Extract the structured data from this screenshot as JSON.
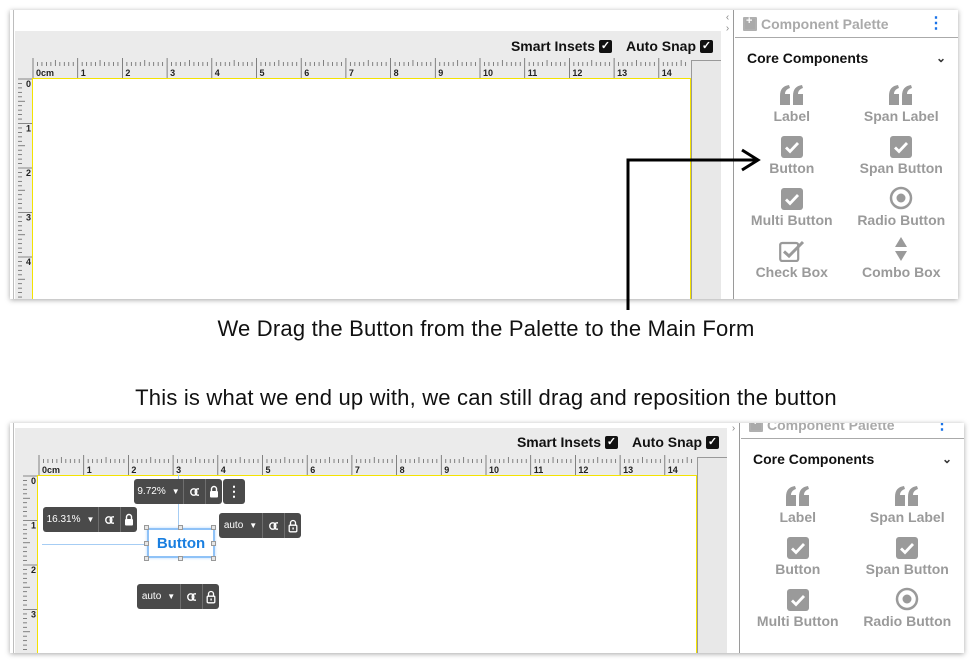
{
  "captions": {
    "top": "We Drag the Button from the Palette to the Main Form",
    "middle": "This is what we end up with, we can still drag and reposition the button"
  },
  "designer": {
    "smart_insets_label": "Smart Insets",
    "smart_insets_checked": true,
    "auto_snap_label": "Auto Snap",
    "auto_snap_checked": true,
    "ruler_unit_label": "0cm",
    "ruler_h_ticks": [
      "1",
      "2",
      "3",
      "4",
      "5",
      "6",
      "7",
      "8",
      "9",
      "10",
      "11",
      "12",
      "13",
      "14"
    ],
    "ruler_v_ticks_shot1": [
      "0",
      "1",
      "2",
      "3",
      "4"
    ],
    "ruler_v_ticks_shot2": [
      "0",
      "1",
      "2",
      "3"
    ]
  },
  "palette": {
    "title": "Component Palette",
    "section": "Core Components",
    "components_shot1": [
      {
        "label": "Label",
        "icon": "quote-icon"
      },
      {
        "label": "Span Label",
        "icon": "quote-icon"
      },
      {
        "label": "Button",
        "icon": "check-square-icon"
      },
      {
        "label": "Span Button",
        "icon": "check-square-icon"
      },
      {
        "label": "Multi Button",
        "icon": "check-square-icon"
      },
      {
        "label": "Radio Button",
        "icon": "radio-icon"
      },
      {
        "label": "Check Box",
        "icon": "checkbox-outline-icon"
      },
      {
        "label": "Combo Box",
        "icon": "updown-icon"
      }
    ],
    "components_shot2": [
      {
        "label": "Label",
        "icon": "quote-icon"
      },
      {
        "label": "Span Label",
        "icon": "quote-icon"
      },
      {
        "label": "Button",
        "icon": "check-square-icon"
      },
      {
        "label": "Span Button",
        "icon": "check-square-icon"
      },
      {
        "label": "Multi Button",
        "icon": "check-square-icon"
      },
      {
        "label": "Radio Button",
        "icon": "radio-icon"
      }
    ]
  },
  "placed_button": {
    "label": "Button",
    "top_inset": "9.72%",
    "left_inset": "16.31%",
    "right_inset": "auto",
    "bottom_inset": "auto",
    "top_locked": true,
    "left_locked": true,
    "right_locked": false,
    "bottom_locked": false
  },
  "colors": {
    "accent": "#1a7fe0",
    "canvas_border": "#f4e300",
    "palette_text": "#9a9a9a",
    "overlay_bg": "#4a4a4a"
  }
}
